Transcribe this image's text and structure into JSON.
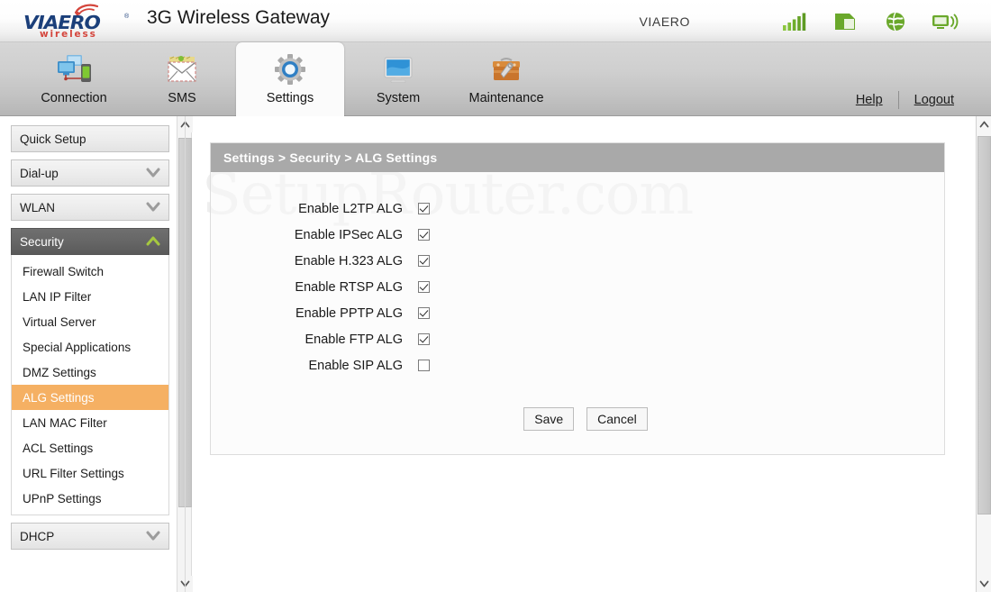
{
  "brand": {
    "logo_text": "VIAERO",
    "logo_tm": "®",
    "logo_sub": "wireless",
    "title": "3G Wireless Gateway",
    "carrier": "VIAERO",
    "status_icons": [
      "signal-bars-icon",
      "sim-card-icon",
      "globe-icon",
      "wifi-monitor-icon"
    ]
  },
  "nav": {
    "tabs": [
      {
        "label": "Connection",
        "icon": "network-computers-icon",
        "active": false
      },
      {
        "label": "SMS",
        "icon": "envelope-icon",
        "active": false
      },
      {
        "label": "Settings",
        "icon": "gear-icon",
        "active": true
      },
      {
        "label": "System",
        "icon": "monitor-icon",
        "active": false
      },
      {
        "label": "Maintenance",
        "icon": "toolbox-wrench-icon",
        "active": false
      }
    ],
    "help_label": "Help",
    "logout_label": "Logout"
  },
  "sidebar": {
    "items": [
      {
        "label": "Quick Setup",
        "type": "button",
        "chevron": "none"
      },
      {
        "label": "Dial-up",
        "type": "button",
        "chevron": "down"
      },
      {
        "label": "WLAN",
        "type": "button",
        "chevron": "down"
      },
      {
        "label": "Security",
        "type": "group",
        "chevron": "up",
        "expanded": true
      },
      {
        "label": "DHCP",
        "type": "button",
        "chevron": "down"
      }
    ],
    "security_subitems": [
      {
        "label": "Firewall Switch",
        "selected": false
      },
      {
        "label": "LAN IP Filter",
        "selected": false
      },
      {
        "label": "Virtual Server",
        "selected": false
      },
      {
        "label": "Special Applications",
        "selected": false
      },
      {
        "label": "DMZ Settings",
        "selected": false
      },
      {
        "label": "ALG Settings",
        "selected": true
      },
      {
        "label": "LAN MAC Filter",
        "selected": false
      },
      {
        "label": "ACL Settings",
        "selected": false
      },
      {
        "label": "URL Filter Settings",
        "selected": false
      },
      {
        "label": "UPnP Settings",
        "selected": false
      }
    ]
  },
  "content": {
    "watermark": "SetupRouter.com",
    "breadcrumb": "Settings > Security > ALG Settings",
    "rows": [
      {
        "label": "Enable L2TP ALG",
        "checked": true
      },
      {
        "label": "Enable IPSec ALG",
        "checked": true
      },
      {
        "label": "Enable H.323 ALG",
        "checked": true
      },
      {
        "label": "Enable RTSP ALG",
        "checked": true
      },
      {
        "label": "Enable PPTP ALG",
        "checked": true
      },
      {
        "label": "Enable FTP ALG",
        "checked": true
      },
      {
        "label": "Enable SIP ALG",
        "checked": false
      }
    ],
    "save_label": "Save",
    "cancel_label": "Cancel"
  },
  "colors": {
    "selected_item": "#f5b063",
    "group_header": "#656565",
    "panel_header": "#a9a9a9",
    "status_icon_green": "#6aa82b",
    "logo_blue": "#1b3f7a",
    "logo_red": "#d4453c"
  }
}
